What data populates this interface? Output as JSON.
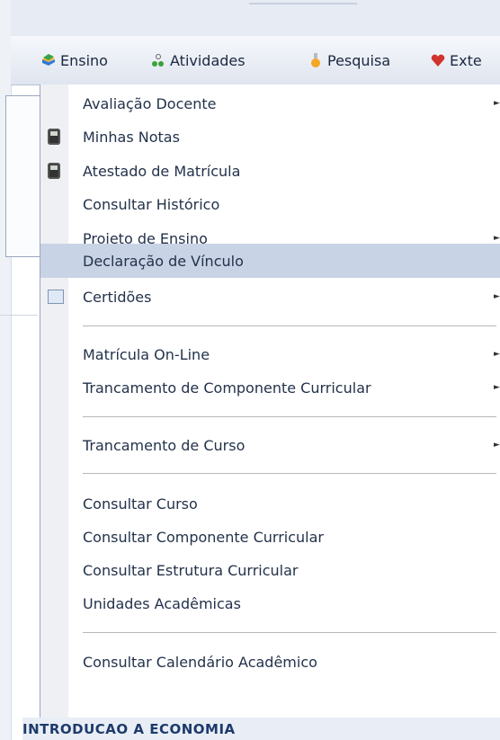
{
  "menubar": {
    "items": [
      {
        "label": "Ensino",
        "icon": "books-icon"
      },
      {
        "label": "Atividades",
        "icon": "people-icon"
      },
      {
        "label": "Pesquisa",
        "icon": "flask-icon"
      },
      {
        "label": "Exte",
        "icon": "heart-icon"
      }
    ]
  },
  "dropdown": {
    "items": [
      {
        "label": "Avaliação Docente",
        "submenu": true
      },
      {
        "label": "Minhas Notas",
        "icon": "phone-icon"
      },
      {
        "label": "Atestado de Matrícula",
        "icon": "phone-icon"
      },
      {
        "label": "Consultar Histórico"
      },
      {
        "label": "Projeto de Ensino",
        "submenu": true
      },
      {
        "label": "Declaração de Vínculo",
        "highlighted": true
      },
      {
        "label": "Certidões",
        "icon": "certificate-icon",
        "submenu": true
      },
      {
        "label": "Matrícula On-Line",
        "submenu": true
      },
      {
        "label": "Trancamento de Componente Curricular",
        "submenu": true
      },
      {
        "label": "Trancamento de Curso",
        "submenu": true
      },
      {
        "label": "Consultar Curso"
      },
      {
        "label": "Consultar Componente Curricular"
      },
      {
        "label": "Consultar Estrutura Curricular"
      },
      {
        "label": "Unidades Acadêmicas"
      },
      {
        "label": "Consultar Calendário Acadêmico"
      }
    ],
    "submenu_arrow": "►"
  },
  "footer": {
    "title": "INTRODUCAO A ECONOMIA"
  },
  "colors": {
    "highlight": "#c9d3e6",
    "menubar": "#dfe5ef",
    "text": "#23324a",
    "footer_text": "#1d3a6b"
  }
}
